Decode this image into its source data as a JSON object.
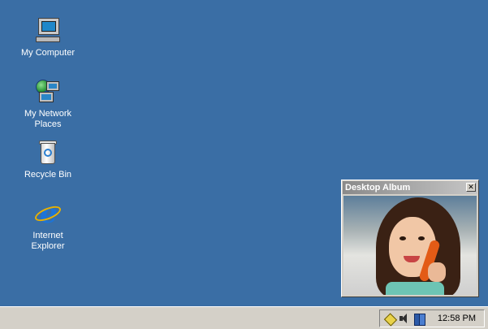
{
  "desktop": {
    "icons": [
      {
        "label": "My Computer",
        "icon": "my-computer-icon"
      },
      {
        "label": "My Network Places",
        "icon": "network-places-icon"
      },
      {
        "label": "Recycle Bin",
        "icon": "recycle-bin-icon"
      },
      {
        "label": "Internet Explorer",
        "icon": "internet-explorer-icon"
      }
    ],
    "background_color": "#3a6ea5"
  },
  "album": {
    "title": "Desktop Album",
    "close_label": "✕"
  },
  "taskbar": {
    "clock": "12:58 PM",
    "tray_icons": [
      "network-tray-icon",
      "volume-tray-icon",
      "book-tray-icon"
    ]
  }
}
